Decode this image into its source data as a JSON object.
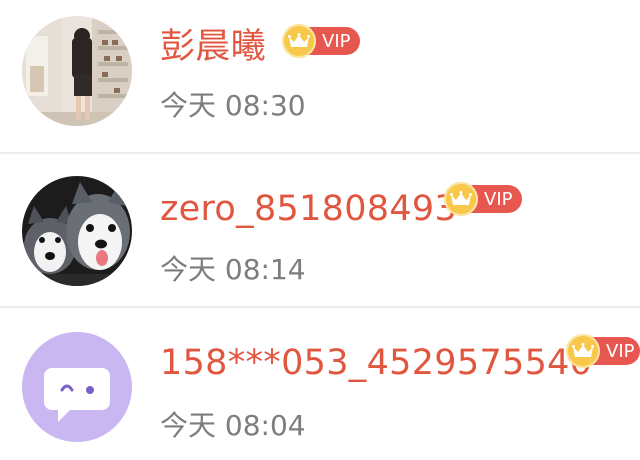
{
  "contacts": [
    {
      "name": "彭晨曦",
      "time": "今天 08:30",
      "vip_label": "VIP",
      "avatar": "photo-avatar-woman-in-store"
    },
    {
      "name": "zero_851808493",
      "time": "今天 08:14",
      "vip_label": "VIP",
      "avatar": "photo-avatar-husky-dogs"
    },
    {
      "name": "158***053_4529575540",
      "time": "今天 08:04",
      "vip_label": "VIP",
      "avatar": "default-avatar-chat-bubble"
    }
  ],
  "colors": {
    "name": "#e0563f",
    "time": "#7d7d7d",
    "vip_tag": "#e6584f",
    "crown": "#f7c84a",
    "default_avatar_bg": "#c9b7f2"
  }
}
